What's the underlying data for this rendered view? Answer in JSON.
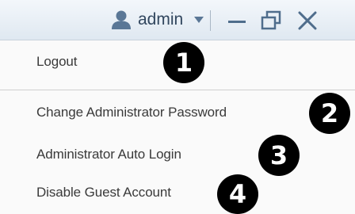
{
  "titlebar": {
    "user_icon": "user-icon",
    "username": "admin",
    "dropdown_icon": "caret-down-icon",
    "buttons": [
      {
        "name": "minimize-button",
        "icon": "minimize-icon"
      },
      {
        "name": "restore-button",
        "icon": "restore-icon"
      },
      {
        "name": "close-button",
        "icon": "close-icon"
      }
    ]
  },
  "menu": {
    "items": [
      {
        "label": "Logout",
        "badge": "1"
      },
      {
        "label": "Change Administrator Password",
        "badge": "2"
      },
      {
        "label": "Administrator Auto Login",
        "badge": "3"
      },
      {
        "label": "Disable Guest Account",
        "badge": "4"
      }
    ]
  },
  "colors": {
    "titlebar_bg": "#e6edf4",
    "icon_blue": "#4f6d8c",
    "menu_bg": "#fafafa",
    "badge_bg": "#000000"
  }
}
